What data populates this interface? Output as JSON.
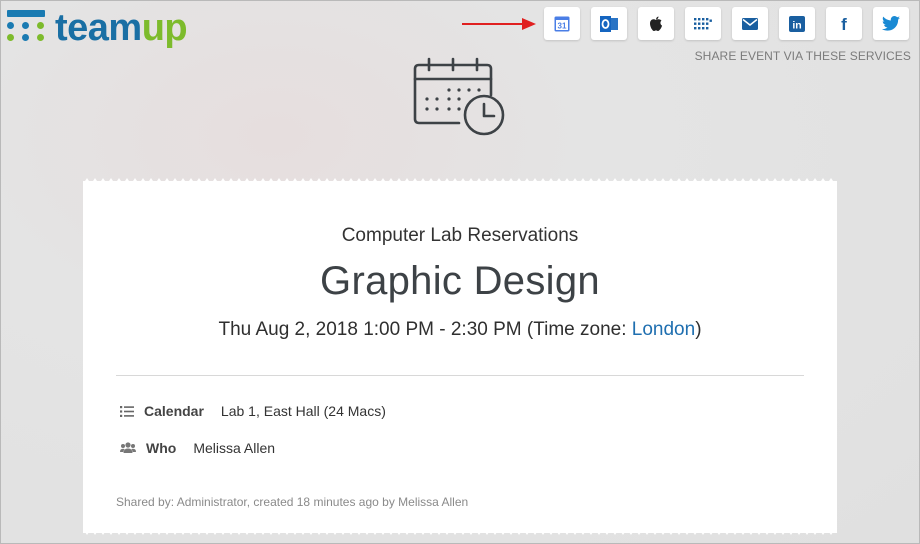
{
  "brand": {
    "name_part1": "team",
    "name_part2": "up",
    "logo_colors": {
      "bar": "#1a7bb2",
      "blue": "#1a6fa4",
      "green": "#7dbb2c"
    }
  },
  "share": {
    "label": "SHARE EVENT VIA THESE SERVICES",
    "services": [
      {
        "name": "google-calendar",
        "text": "31"
      },
      {
        "name": "outlook",
        "text": ""
      },
      {
        "name": "apple",
        "text": ""
      },
      {
        "name": "ical-feed",
        "text": ""
      },
      {
        "name": "email",
        "text": ""
      },
      {
        "name": "linkedin",
        "text": "in"
      },
      {
        "name": "facebook",
        "text": "f"
      },
      {
        "name": "twitter",
        "text": ""
      }
    ],
    "annotation_color": "#e02020"
  },
  "event": {
    "calendar_name": "Computer Lab Reservations",
    "title": "Graphic Design",
    "time_prefix": "Thu Aug 2, 2018 1:00 PM - 2:30 PM (Time zone: ",
    "timezone_link": "London",
    "time_suffix": ")",
    "details": {
      "calendar_label": "Calendar",
      "calendar_value": "Lab 1, East Hall (24 Macs)",
      "who_label": "Who",
      "who_value": "Melissa Allen"
    },
    "shared_by": "Shared by: Administrator, created 18 minutes ago by Melissa Allen"
  },
  "colors": {
    "link": "#1f6fb0",
    "text": "#333333",
    "muted": "#8a8a8a"
  }
}
